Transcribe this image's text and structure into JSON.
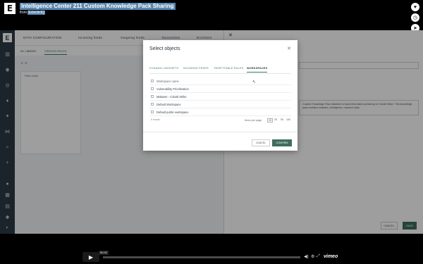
{
  "video": {
    "logo_letter": "E",
    "title": "Intelligence Center 211 Custom Knowledge Pack Sharing",
    "from_prefix": "from",
    "author": "EclecticIQ",
    "time": "00:32",
    "progress": 0.0,
    "brand": "vimeo",
    "side_icons": [
      "heart-icon",
      "clock-icon",
      "send-icon"
    ]
  },
  "nav": {
    "logo_letter": "E",
    "icons": [
      "chart-icon",
      "dashboard-icon",
      "target-icon",
      "bell-icon",
      "settings-icon",
      "graph-icon",
      "search-icon",
      "plus-icon",
      "notification-icon",
      "calendar-icon",
      "folder-icon",
      "gear-icon",
      "user-icon"
    ]
  },
  "main_tabs": [
    "DATA CONFIGURATION",
    "Incoming feeds",
    "Outgoing feeds",
    "Taxonomies",
    "Enrichers"
  ],
  "sub_tabs": [
    "MY LIBRARY",
    "CREATED PACKS"
  ],
  "list_header": "Pack name",
  "right_panel": {
    "description_text": "Custom Knowledge Pack datasets to track information pertaining to Cobalt Strike. This knowledge pack contains malware, intelligence, research data.",
    "cancel_label": "CANCEL",
    "save_label": "SAVE"
  },
  "modal": {
    "title": "Select objects",
    "tabs": [
      "DYNAMIC DATASETS",
      "INCOMING FEEDS",
      "RESETTABLE RULES",
      "WORKSPACES"
    ],
    "active_tab": "WORKSPACES",
    "column_header": "Workspace name",
    "rows": [
      "Vulnerability Prioritization",
      "Malware - Cobalt Strike",
      "Default Workspace",
      "Default public workspace"
    ],
    "results": "5 results",
    "items_per_page_label": "Items per page:",
    "page_sizes": [
      "10",
      "25",
      "50",
      "100"
    ],
    "selected_page_size": "10",
    "cancel_label": "CANCEL",
    "confirm_label": "CONFIRM"
  },
  "colors": {
    "accent": "#3f6d5e",
    "title_highlight": "#5a87b0",
    "nav_bg": "#2e3b46"
  }
}
